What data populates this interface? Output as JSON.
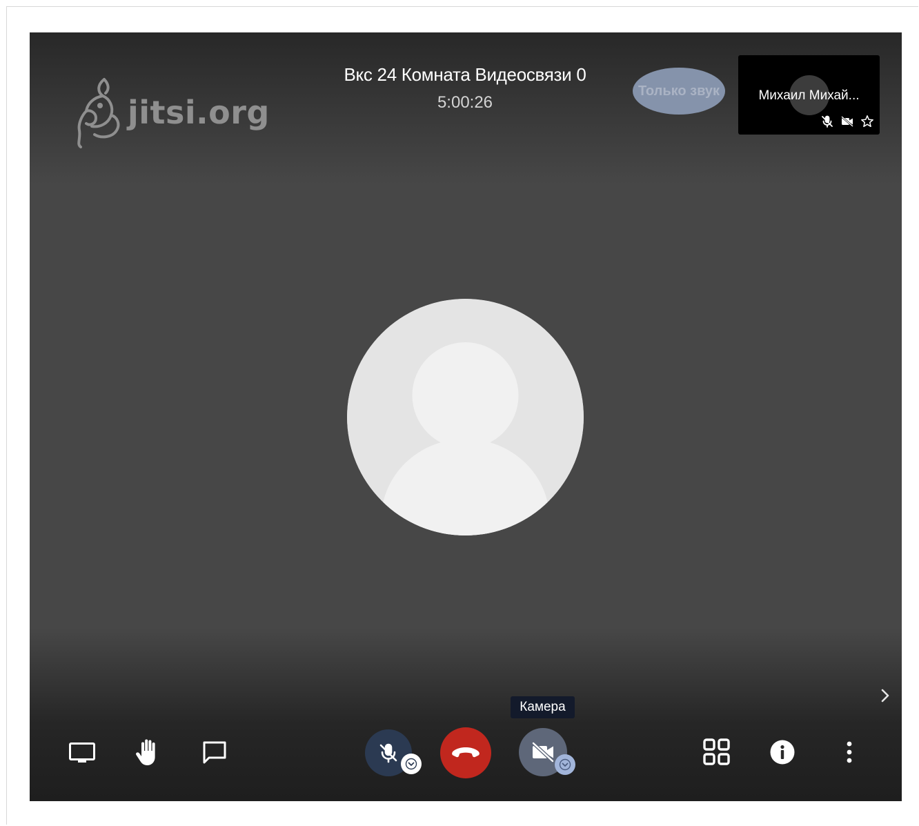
{
  "logo": {
    "text": "jitsi.org"
  },
  "conference": {
    "title": "Вкс 24 Комната Видеосвязи 0",
    "timer": "5:00:26"
  },
  "audio_only_label": "Только звук",
  "thumbnail": {
    "participant_name": "Михаил Михай...",
    "status_icons": [
      "mic-muted-icon",
      "camera-off-icon",
      "moderator-star-icon"
    ]
  },
  "tooltip": {
    "text": "Камера"
  },
  "toolbar": {
    "left": [
      "screen-share-icon",
      "raise-hand-icon",
      "chat-icon"
    ],
    "center": [
      "mic-muted-icon",
      "hangup-icon",
      "camera-off-icon"
    ],
    "right": [
      "tile-view-icon",
      "info-icon",
      "more-options-icon"
    ]
  },
  "colors": {
    "stage_background": "#474747",
    "hangup": "#c1271e",
    "mic_button": "#2b3a52",
    "camera_button": "#5e6779",
    "tooltip_background": "#131a2b",
    "audio_only_badge": "#8593ab"
  }
}
